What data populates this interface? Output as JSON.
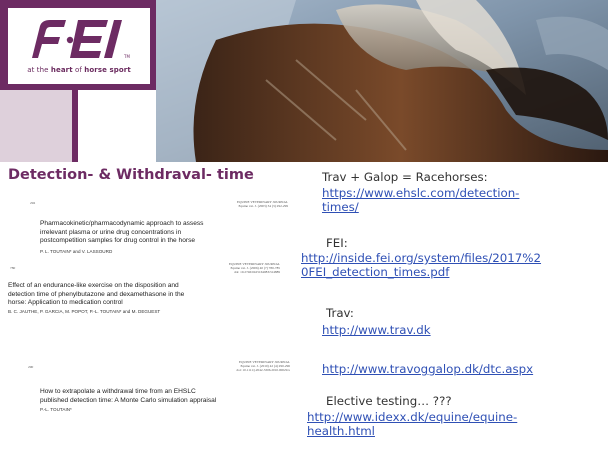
{
  "header": {
    "logo_text": "FEI",
    "tagline_prefix": "at the ",
    "tagline_bold1": "heart",
    "tagline_mid": " of ",
    "tagline_bold2": "horse sport",
    "brand_color": "#6d2b63",
    "lilac_color": "#ded0db"
  },
  "left": {
    "section_title": "Detection- & Withdraval- time",
    "papers": [
      {
        "page_no": "292",
        "journal": "EQUINE VETERINARY JOURNAL",
        "ref1": "Equine vet. J. (2003) 34 (3) 292-299",
        "title_lines": [
          "Pharmacokinetic/pharmacodynamic approach to assess",
          "irrelevant plasma or urine drug concentrations in",
          "postcompetition samples for drug control in the horse"
        ],
        "authors": "P. L. TOUTAIN* and V. LASSOURD"
      },
      {
        "page_no": "780",
        "journal": "EQUINE VETERINARY JOURNAL",
        "ref1": "Equine vet. J. (2006) 40 (7) 780-785",
        "ref2": "doi: 10.2746/042516408X314889",
        "title_lines": [
          "Effect of an endurance-like exercise on the disposition and",
          "detection time of phenylbutazone and dexamethasone in the",
          "horse: Application to medication control"
        ],
        "authors": "B. C. JAUTHE, P. GARCIA, M. POPOT, P.-L. TOUTAIN* and M. DEGUEST"
      },
      {
        "page_no": "290",
        "journal": "EQUINE VETERINARY JOURNAL",
        "ref1": "Equine vet. J. (2010) 42 (4) 290-296",
        "ref2": "doi: 10.1111/j.2042-3306.2010.00029.x",
        "title_lines": [
          "How to extrapolate a withdrawal time from an EHSLC",
          "published detection time: A Monte Carlo simulation appraisal"
        ],
        "authors": "P.-L. TOUTAIN*"
      }
    ]
  },
  "right": {
    "items": [
      {
        "label": "Trav + Galop = Racehorses:",
        "link_lines": [
          "https://www.ehslc.com/detection-",
          "times/"
        ]
      },
      {
        "label": "FEI:",
        "link_lines": [
          "http://inside.fei.org/system/files/2017%2",
          "0FEI_detection_times.pdf"
        ]
      },
      {
        "label": "Trav:",
        "link_lines": [
          "http://www.trav.dk"
        ]
      },
      {
        "label": "",
        "link_lines": [
          "http://www.travoggalop.dk/dtc.aspx"
        ]
      },
      {
        "label": "Elective testing… ???",
        "link_lines": [
          "http://www.idexx.dk/equine/equine-",
          "health.html"
        ]
      }
    ],
    "link_color": "#2f50b5"
  }
}
